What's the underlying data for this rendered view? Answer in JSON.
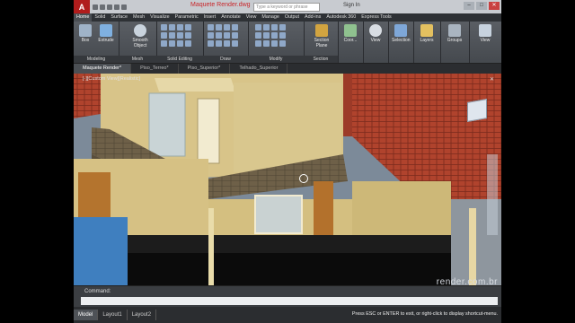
{
  "app": {
    "logo": "A",
    "document_title": "Maquete Render.dwg",
    "search_placeholder": "Type a keyword or phrase",
    "sign_in": "Sign In"
  },
  "ribbon_tabs": [
    "Home",
    "Solid",
    "Surface",
    "Mesh",
    "Visualize",
    "Parametric",
    "Insert",
    "Annotate",
    "View",
    "Manage",
    "Output",
    "Add-ins",
    "Autodesk 360",
    "Express Tools"
  ],
  "ribbon_groups": {
    "modeling": {
      "label": "Modeling",
      "box": "Box",
      "extrude": "Extrude"
    },
    "mesh": {
      "label": "Mesh",
      "smooth": "Smooth Object"
    },
    "solid_editing": {
      "label": "Solid Editing"
    },
    "draw": {
      "label": "Draw"
    },
    "modify": {
      "label": "Modify"
    },
    "section": {
      "label": "Section",
      "section_plane": "Section Plane"
    },
    "coordinates": {
      "label": "Coor..."
    },
    "view": {
      "label": "View"
    },
    "selection": {
      "label": "Selection"
    },
    "layers": {
      "label": "Layers"
    },
    "groups": {
      "label": "Groups"
    },
    "view2": {
      "label": "View"
    }
  },
  "doc_tabs": [
    "Maquete Render*",
    "Piso_Terreo*",
    "Piso_Superior*",
    "Telhado_Superior"
  ],
  "viewport": {
    "label": "[-][Custom View][Realistic]"
  },
  "command": {
    "history": "Command:",
    "prompt": ""
  },
  "layout_tabs": [
    "Model",
    "Layout1",
    "Layout2"
  ],
  "status_message": "Press ESC or ENTER to exit, or right-click to display shortcut-menu.",
  "watermark": "render.com.br",
  "colors": {
    "accent": "#c8262a",
    "roof": "#b5432e",
    "wall": "#d9c48a"
  }
}
